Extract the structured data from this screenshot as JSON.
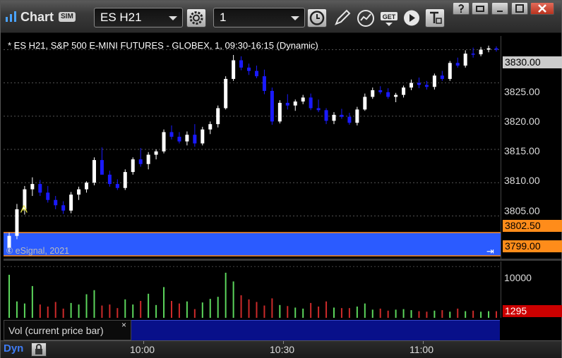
{
  "window": {
    "title": "Chart",
    "sim_badge": "SIM",
    "symbol": "ES H21",
    "interval": "1"
  },
  "toolbar": {
    "icons": [
      "gear-icon",
      "clock-icon",
      "pencil-icon",
      "study-icon",
      "get-icon",
      "play-icon",
      "text-icon"
    ],
    "get_label": "GET"
  },
  "chart": {
    "caption": "* ES H21, S&P 500 E-MINI FUTURES - GLOBEX, 1, 09:30-16:15 (Dynamic)",
    "watermark": "© eSignal, 2021",
    "marker": "A",
    "colors": {
      "up": "#ffffff",
      "down": "#1a1aff",
      "band": "#2b5bff",
      "flag": "#ff8c1a",
      "vol_up": "#5cd65c",
      "vol_down": "#cc2a2a",
      "vol_flag": "#cc0000"
    }
  },
  "price_axis": {
    "labels": [
      "3830.00",
      "3825.00",
      "3820.00",
      "3815.00",
      "3810.00",
      "3805.00"
    ],
    "last_price": "3830.00",
    "band_high": "3802.50",
    "band_low": "3799.00"
  },
  "volume": {
    "pane_label": "Vol (current price bar)",
    "close_glyph": "×",
    "axis_label": "10000",
    "last_volume": "1295"
  },
  "time_axis": {
    "dyn_label": "Dyn",
    "labels": [
      "10:00",
      "10:30",
      "11:00"
    ]
  },
  "chart_data": {
    "type": "candlestick",
    "title": "* ES H21, S&P 500 E-MINI FUTURES - GLOBEX, 1, 09:30-16:15 (Dynamic)",
    "ylim": [
      3799,
      3831
    ],
    "bars": [
      [
        3800.2,
        3802.5,
        3799.5,
        3802.0
      ],
      [
        3802.0,
        3806.8,
        3801.5,
        3806.0
      ],
      [
        3806.0,
        3809.5,
        3805.2,
        3809.0
      ],
      [
        3809.0,
        3810.8,
        3808.0,
        3809.8
      ],
      [
        3809.8,
        3810.4,
        3808.0,
        3808.5
      ],
      [
        3808.5,
        3809.5,
        3807.0,
        3807.4
      ],
      [
        3807.4,
        3808.0,
        3806.0,
        3806.6
      ],
      [
        3806.6,
        3807.2,
        3805.3,
        3805.8
      ],
      [
        3805.8,
        3808.6,
        3805.4,
        3808.2
      ],
      [
        3808.2,
        3809.4,
        3807.4,
        3809.0
      ],
      [
        3809.0,
        3810.2,
        3808.5,
        3810.0
      ],
      [
        3810.0,
        3813.8,
        3809.6,
        3813.4
      ],
      [
        3813.4,
        3815.3,
        3812.6,
        3811.2
      ],
      [
        3811.2,
        3811.8,
        3809.4,
        3809.8
      ],
      [
        3809.8,
        3810.5,
        3808.9,
        3809.2
      ],
      [
        3809.2,
        3812.0,
        3808.9,
        3811.6
      ],
      [
        3811.6,
        3813.8,
        3811.2,
        3813.5
      ],
      [
        3813.5,
        3815.2,
        3812.4,
        3812.8
      ],
      [
        3812.8,
        3814.6,
        3812.0,
        3814.2
      ],
      [
        3814.2,
        3815.0,
        3813.5,
        3814.7
      ],
      [
        3814.7,
        3818.0,
        3814.4,
        3817.6
      ],
      [
        3817.6,
        3818.6,
        3816.5,
        3816.9
      ],
      [
        3816.9,
        3817.6,
        3815.9,
        3816.2
      ],
      [
        3816.2,
        3817.7,
        3815.6,
        3817.2
      ],
      [
        3817.2,
        3818.8,
        3815.4,
        3815.9
      ],
      [
        3815.9,
        3818.4,
        3815.6,
        3818.0
      ],
      [
        3818.0,
        3819.2,
        3817.3,
        3818.8
      ],
      [
        3818.8,
        3821.6,
        3818.3,
        3821.2
      ],
      [
        3821.2,
        3826.0,
        3821.0,
        3825.6
      ],
      [
        3825.6,
        3829.2,
        3825.3,
        3828.4
      ],
      [
        3828.4,
        3829.0,
        3826.9,
        3827.3
      ],
      [
        3827.3,
        3827.9,
        3826.2,
        3826.8
      ],
      [
        3826.8,
        3827.6,
        3825.7,
        3826.0
      ],
      [
        3826.0,
        3827.0,
        3823.3,
        3823.8
      ],
      [
        3823.8,
        3824.3,
        3818.7,
        3819.2
      ],
      [
        3819.2,
        3822.4,
        3818.9,
        3822.0
      ],
      [
        3822.0,
        3823.3,
        3821.0,
        3821.6
      ],
      [
        3821.6,
        3822.5,
        3820.8,
        3822.2
      ],
      [
        3822.2,
        3823.2,
        3821.8,
        3822.8
      ],
      [
        3822.8,
        3823.4,
        3820.9,
        3821.2
      ],
      [
        3821.2,
        3822.5,
        3820.6,
        3820.9
      ],
      [
        3820.9,
        3821.2,
        3818.8,
        3819.3
      ],
      [
        3819.3,
        3820.6,
        3818.8,
        3820.2
      ],
      [
        3820.2,
        3821.1,
        3819.6,
        3819.9
      ],
      [
        3819.9,
        3820.5,
        3818.7,
        3819.0
      ],
      [
        3819.0,
        3821.4,
        3818.6,
        3821.0
      ],
      [
        3821.0,
        3823.4,
        3820.8,
        3822.9
      ],
      [
        3822.9,
        3824.3,
        3822.6,
        3823.9
      ],
      [
        3823.9,
        3824.5,
        3823.3,
        3823.6
      ],
      [
        3823.6,
        3824.2,
        3822.6,
        3822.9
      ],
      [
        3822.9,
        3823.5,
        3822.1,
        3823.2
      ],
      [
        3823.2,
        3824.6,
        3822.8,
        3824.3
      ],
      [
        3824.3,
        3825.5,
        3823.9,
        3825.0
      ],
      [
        3825.0,
        3825.8,
        3824.2,
        3824.7
      ],
      [
        3824.7,
        3825.3,
        3824.0,
        3824.4
      ],
      [
        3824.4,
        3826.4,
        3824.0,
        3826.1
      ],
      [
        3826.1,
        3826.8,
        3825.3,
        3825.6
      ],
      [
        3825.6,
        3828.3,
        3825.3,
        3828.0
      ],
      [
        3828.0,
        3828.8,
        3827.3,
        3827.6
      ],
      [
        3827.6,
        3829.9,
        3827.3,
        3829.4
      ],
      [
        3829.4,
        3830.3,
        3828.8,
        3829.3
      ],
      [
        3829.3,
        3830.4,
        3829.0,
        3830.0
      ],
      [
        3830.0,
        3830.6,
        3829.6,
        3830.2
      ],
      [
        3830.2,
        3830.5,
        3829.7,
        3830.0
      ]
    ],
    "volume_ylim": [
      0,
      11000
    ],
    "volume": [
      8400,
      3200,
      2800,
      6200,
      2600,
      2200,
      3100,
      1800,
      2900,
      2600,
      4600,
      5400,
      2400,
      2600,
      1900,
      3600,
      2600,
      3300,
      4700,
      2500,
      6000,
      3300,
      2800,
      3200,
      1700,
      3000,
      3700,
      4100,
      8800,
      7100,
      4400,
      3600,
      3100,
      2400,
      3800,
      2500,
      2300,
      2000,
      1800,
      2900,
      2200,
      3200,
      2000,
      1900,
      1900,
      2200,
      2800,
      1600,
      1800,
      1400,
      1600,
      1700,
      1500,
      1300,
      1200,
      1400,
      1500,
      1200,
      1800,
      1300,
      1400,
      1200,
      1300,
      1295
    ]
  }
}
